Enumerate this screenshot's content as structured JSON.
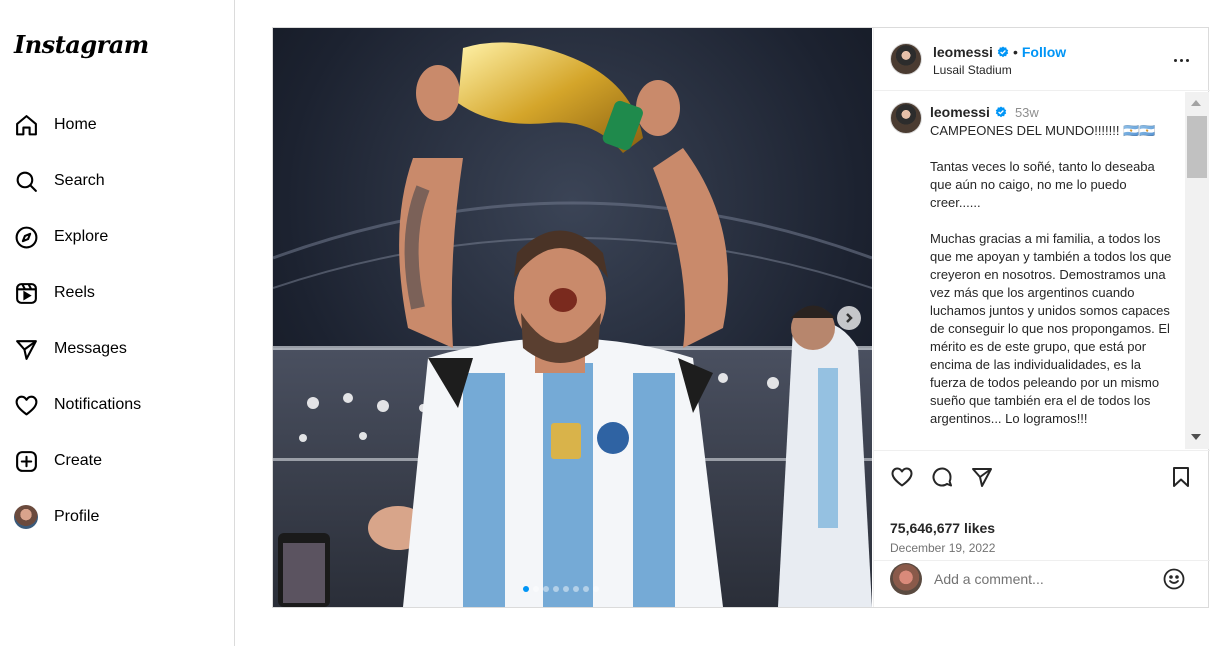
{
  "brand": {
    "logo": "Instagram"
  },
  "sidebar": {
    "items": [
      {
        "label": "Home",
        "icon": "home-icon"
      },
      {
        "label": "Search",
        "icon": "search-icon"
      },
      {
        "label": "Explore",
        "icon": "compass-icon"
      },
      {
        "label": "Reels",
        "icon": "reels-icon"
      },
      {
        "label": "Messages",
        "icon": "paper-plane-icon"
      },
      {
        "label": "Notifications",
        "icon": "heart-icon"
      },
      {
        "label": "Create",
        "icon": "plus-square-icon"
      },
      {
        "label": "Profile",
        "icon": "profile-avatar"
      }
    ]
  },
  "post": {
    "author": "leomessi",
    "verified": true,
    "separator": "•",
    "follow_label": "Follow",
    "location": "Lusail Stadium",
    "carousel": {
      "slide_count": 8,
      "active_index": 0
    },
    "caption": {
      "author": "leomessi",
      "time": "53w",
      "text": "CAMPEONES DEL MUNDO!!!!!!! 🇦🇷🇦🇷\n\nTantas veces lo soñé, tanto lo deseaba que aún no caigo, no me lo puedo creer......\n\nMuchas gracias a mi familia, a todos los que me apoyan y también a todos los que creyeron en nosotros. Demostramos una vez más que los argentinos cuando luchamos juntos y unidos somos capaces de conseguir lo que nos propongamos. El mérito es de este grupo, que está por encima de las individualidades, es la fuerza de todos peleando por un mismo sueño que también era el de todos los argentinos... Lo logramos!!!"
    },
    "likes": "75,646,677 likes",
    "date": "December 19, 2022",
    "comment_placeholder": "Add a comment...",
    "colors": {
      "accent": "#0095f6",
      "border": "#dbdbdb"
    }
  }
}
